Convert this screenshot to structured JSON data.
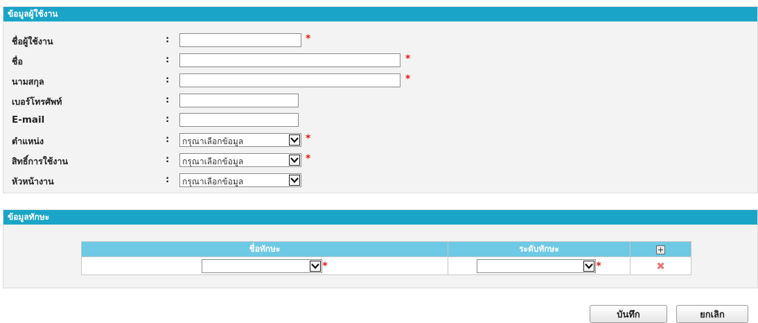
{
  "user_section": {
    "title": "ข้อมูลผู้ใช้งาน",
    "fields": {
      "username": {
        "label": "ชื่อผู้ใช้งาน",
        "value": ""
      },
      "firstname": {
        "label": "ชื่อ",
        "value": ""
      },
      "lastname": {
        "label": "นามสกุล",
        "value": ""
      },
      "phone": {
        "label": "เบอร์โทรศัพท์",
        "value": ""
      },
      "email": {
        "label": "E-mail",
        "value": ""
      },
      "position": {
        "label": "ตำแหน่ง",
        "selected": "กรุณาเลือกข้อมูล"
      },
      "permission": {
        "label": "สิทธิ์การใช้งาน",
        "selected": "กรุณาเลือกข้อมูล"
      },
      "supervisor": {
        "label": "หัวหน้างาน",
        "selected": "กรุณาเลือกข้อมูล"
      }
    },
    "colon": ":",
    "required_mark": "*"
  },
  "skill_section": {
    "title": "ข้อมูลทักษะ",
    "columns": [
      "ชื่อทักษะ",
      "ระดับทักษะ"
    ],
    "rows": [
      {
        "skill_name": "",
        "skill_level": ""
      }
    ],
    "add_icon": "plus-box-icon",
    "delete_icon": "red-x-icon",
    "delete_glyph": "✖"
  },
  "buttons": {
    "save": "บันทึก",
    "cancel": "ยกเลิก"
  },
  "colors": {
    "header": "#1aa5c8",
    "table_header": "#6ec9e4",
    "required": "#e01818",
    "panel_bg": "#f3f3f3"
  }
}
